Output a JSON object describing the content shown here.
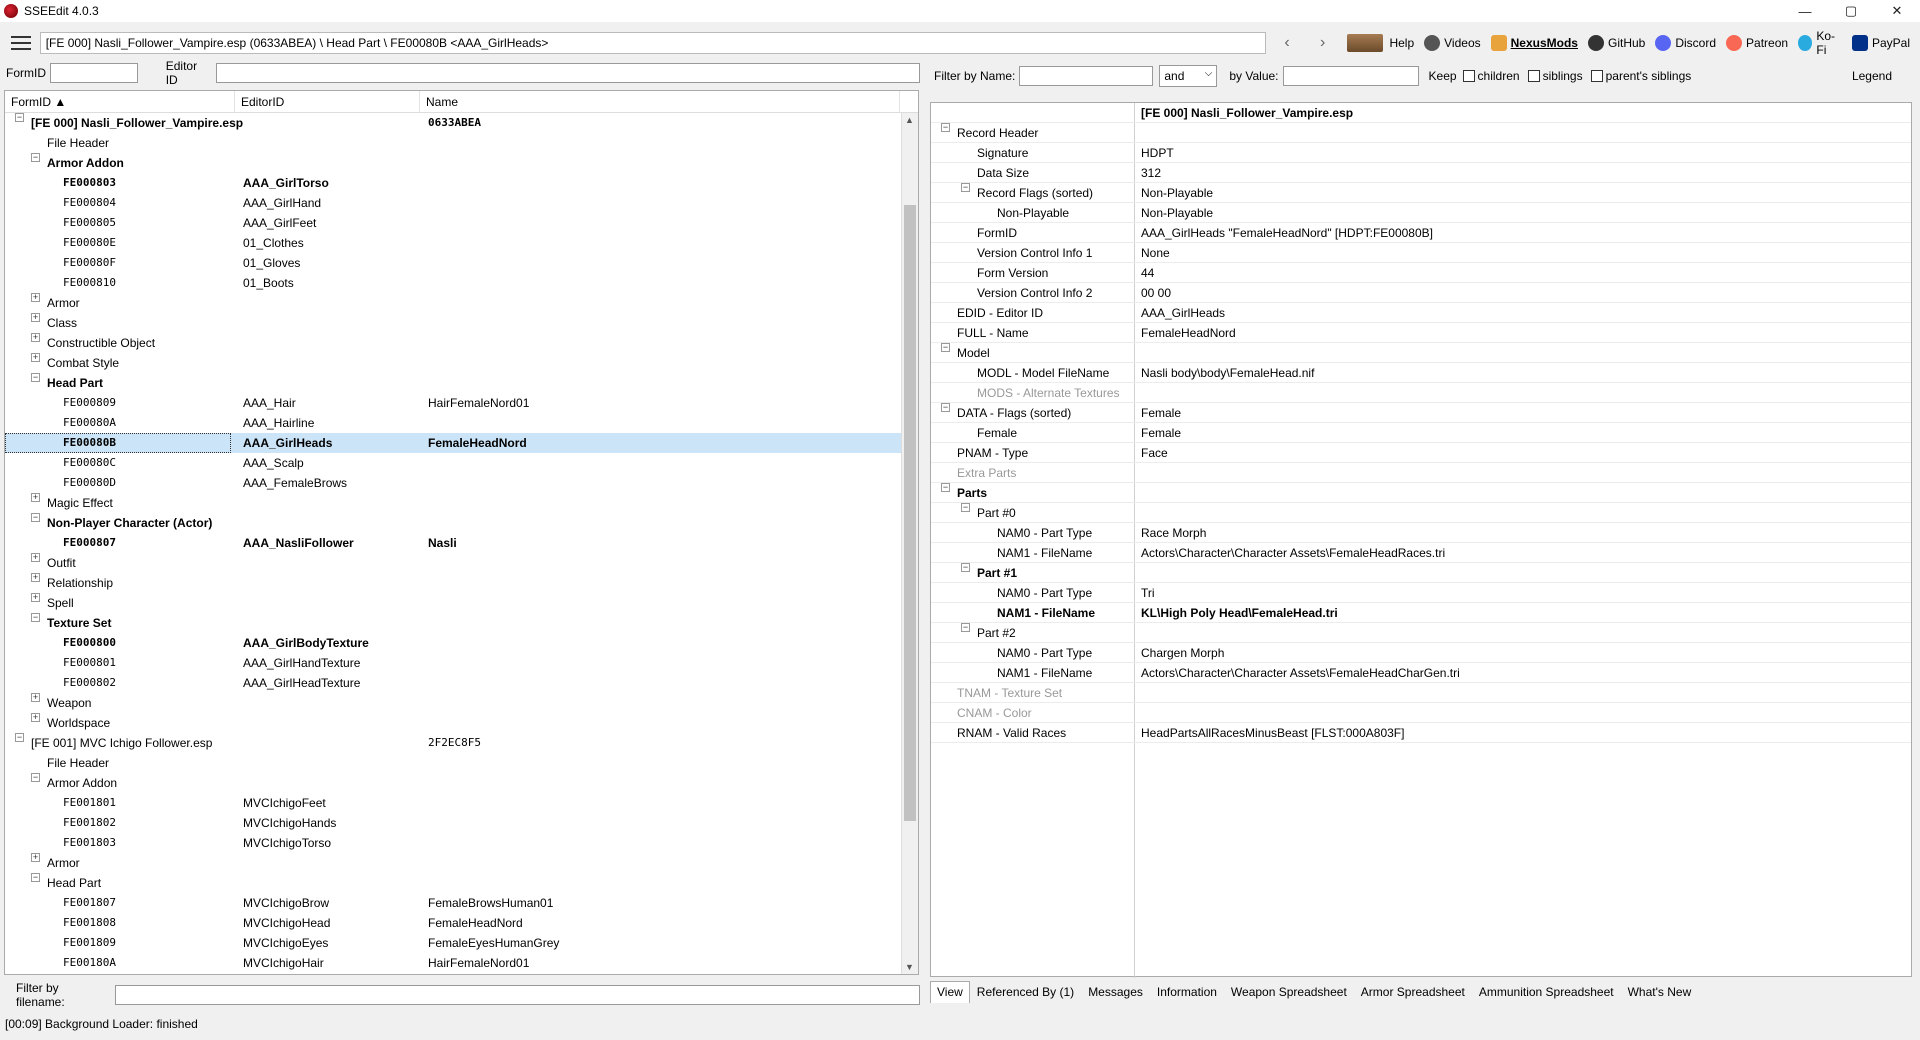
{
  "window": {
    "title": "SSEEdit 4.0.3",
    "min": "—",
    "max": "▢",
    "close": "✕"
  },
  "toolbar": {
    "path": "[FE 000] Nasli_Follower_Vampire.esp (0633ABEA) \\ Head Part \\ FE00080B <AAA_GirlHeads>",
    "back": "‹",
    "fwd": "›",
    "links": [
      "Help",
      "Videos",
      "NexusMods",
      "GitHub",
      "Discord",
      "Patreon",
      "Ko-Fi",
      "PayPal"
    ]
  },
  "leftfilter": {
    "formid_label": "FormID",
    "editorid_label": "Editor ID"
  },
  "lefttree": {
    "headers": [
      "FormID ▲",
      "EditorID",
      "Name"
    ],
    "rows": [
      {
        "d": 0,
        "e": "−",
        "id": "[FE 000] Nasli_Follower_Vampire.esp",
        "c3": "0633ABEA",
        "b": true
      },
      {
        "d": 1,
        "e": "",
        "id": "File Header"
      },
      {
        "d": 1,
        "e": "−",
        "id": "Armor Addon",
        "b": true
      },
      {
        "d": 2,
        "e": "",
        "id": "FE000803",
        "c2": "AAA_GirlTorso",
        "m": true,
        "b2": true
      },
      {
        "d": 2,
        "e": "",
        "id": "FE000804",
        "c2": "AAA_GirlHand",
        "m": true
      },
      {
        "d": 2,
        "e": "",
        "id": "FE000805",
        "c2": "AAA_GirlFeet",
        "m": true
      },
      {
        "d": 2,
        "e": "",
        "id": "FE00080E",
        "c2": "01_Clothes",
        "m": true
      },
      {
        "d": 2,
        "e": "",
        "id": "FE00080F",
        "c2": "01_Gloves",
        "m": true
      },
      {
        "d": 2,
        "e": "",
        "id": "FE000810",
        "c2": "01_Boots",
        "m": true
      },
      {
        "d": 1,
        "e": "+",
        "id": "Armor"
      },
      {
        "d": 1,
        "e": "+",
        "id": "Class"
      },
      {
        "d": 1,
        "e": "+",
        "id": "Constructible Object"
      },
      {
        "d": 1,
        "e": "+",
        "id": "Combat Style"
      },
      {
        "d": 1,
        "e": "−",
        "id": "Head Part",
        "b": true
      },
      {
        "d": 2,
        "e": "",
        "id": "FE000809",
        "c2": "AAA_Hair",
        "c3": "HairFemaleNord01",
        "m": true
      },
      {
        "d": 2,
        "e": "",
        "id": "FE00080A",
        "c2": "AAA_Hairline",
        "m": true
      },
      {
        "d": 2,
        "e": "",
        "id": "FE00080B",
        "c2": "AAA_GirlHeads",
        "c3": "FemaleHeadNord",
        "m": true,
        "b2": true,
        "sel": true
      },
      {
        "d": 2,
        "e": "",
        "id": "FE00080C",
        "c2": "AAA_Scalp",
        "m": true
      },
      {
        "d": 2,
        "e": "",
        "id": "FE00080D",
        "c2": "AAA_FemaleBrows",
        "m": true
      },
      {
        "d": 1,
        "e": "+",
        "id": "Magic Effect"
      },
      {
        "d": 1,
        "e": "−",
        "id": "Non-Player Character (Actor)",
        "b": true
      },
      {
        "d": 2,
        "e": "",
        "id": "FE000807",
        "c2": "AAA_NasliFollower",
        "c3": "Nasli",
        "m": true,
        "b2": true
      },
      {
        "d": 1,
        "e": "+",
        "id": "Outfit"
      },
      {
        "d": 1,
        "e": "+",
        "id": "Relationship"
      },
      {
        "d": 1,
        "e": "+",
        "id": "Spell"
      },
      {
        "d": 1,
        "e": "−",
        "id": "Texture Set",
        "b": true
      },
      {
        "d": 2,
        "e": "",
        "id": "FE000800",
        "c2": "AAA_GirlBodyTexture",
        "m": true,
        "b2": true
      },
      {
        "d": 2,
        "e": "",
        "id": "FE000801",
        "c2": "AAA_GirlHandTexture",
        "m": true
      },
      {
        "d": 2,
        "e": "",
        "id": "FE000802",
        "c2": "AAA_GirlHeadTexture",
        "m": true
      },
      {
        "d": 1,
        "e": "+",
        "id": "Weapon"
      },
      {
        "d": 1,
        "e": "+",
        "id": "Worldspace"
      },
      {
        "d": 0,
        "e": "−",
        "id": "[FE 001] MVC Ichigo Follower.esp",
        "c3": "2F2EC8F5"
      },
      {
        "d": 1,
        "e": "",
        "id": "File Header"
      },
      {
        "d": 1,
        "e": "−",
        "id": "Armor Addon"
      },
      {
        "d": 2,
        "e": "",
        "id": "FE001801",
        "c2": "MVCIchigoFeet",
        "m": true
      },
      {
        "d": 2,
        "e": "",
        "id": "FE001802",
        "c2": "MVCIchigoHands",
        "m": true
      },
      {
        "d": 2,
        "e": "",
        "id": "FE001803",
        "c2": "MVCIchigoTorso",
        "m": true
      },
      {
        "d": 1,
        "e": "+",
        "id": "Armor"
      },
      {
        "d": 1,
        "e": "−",
        "id": "Head Part"
      },
      {
        "d": 2,
        "e": "",
        "id": "FE001807",
        "c2": "MVCIchigoBrow",
        "c3": "FemaleBrowsHuman01",
        "m": true
      },
      {
        "d": 2,
        "e": "",
        "id": "FE001808",
        "c2": "MVCIchigoHead",
        "c3": "FemaleHeadNord",
        "m": true
      },
      {
        "d": 2,
        "e": "",
        "id": "FE001809",
        "c2": "MVCIchigoEyes",
        "c3": "FemaleEyesHumanGrey",
        "m": true
      },
      {
        "d": 2,
        "e": "",
        "id": "FE00180A",
        "c2": "MVCIchigoHair",
        "c3": "HairFemaleNord01",
        "m": true
      }
    ]
  },
  "filefilter": {
    "label": "Filter by filename:"
  },
  "rightfilter": {
    "byname": "Filter by Name:",
    "op": "and",
    "byvalue": "by Value:",
    "keep": "Keep",
    "children": "children",
    "siblings": "siblings",
    "parents": "parent's siblings",
    "legend": "Legend"
  },
  "righttree": {
    "header": "[FE 000] Nasli_Follower_Vampire.esp",
    "rows": [
      {
        "d": 0,
        "e": "−",
        "k": "Record Header",
        "v": ""
      },
      {
        "d": 1,
        "e": "",
        "k": "Signature",
        "v": "HDPT"
      },
      {
        "d": 1,
        "e": "",
        "k": "Data Size",
        "v": "312"
      },
      {
        "d": 1,
        "e": "−",
        "k": "Record Flags (sorted)",
        "v": "Non-Playable"
      },
      {
        "d": 2,
        "e": "",
        "k": "Non-Playable",
        "v": "Non-Playable"
      },
      {
        "d": 1,
        "e": "",
        "k": "FormID",
        "v": "AAA_GirlHeads \"FemaleHeadNord\" [HDPT:FE00080B]"
      },
      {
        "d": 1,
        "e": "",
        "k": "Version Control Info 1",
        "v": "None"
      },
      {
        "d": 1,
        "e": "",
        "k": "Form Version",
        "v": "44"
      },
      {
        "d": 1,
        "e": "",
        "k": "Version Control Info 2",
        "v": "00 00"
      },
      {
        "d": 0,
        "e": "",
        "k": "EDID - Editor ID",
        "v": "AAA_GirlHeads"
      },
      {
        "d": 0,
        "e": "",
        "k": "FULL - Name",
        "v": "FemaleHeadNord"
      },
      {
        "d": 0,
        "e": "−",
        "k": "Model",
        "v": ""
      },
      {
        "d": 1,
        "e": "",
        "k": "MODL - Model FileName",
        "v": "Nasli body\\body\\FemaleHead.nif"
      },
      {
        "d": 1,
        "e": "",
        "k": "MODS - Alternate Textures",
        "v": "",
        "g": true
      },
      {
        "d": 0,
        "e": "−",
        "k": "DATA - Flags (sorted)",
        "v": "Female"
      },
      {
        "d": 1,
        "e": "",
        "k": "Female",
        "v": "Female"
      },
      {
        "d": 0,
        "e": "",
        "k": "PNAM - Type",
        "v": "Face"
      },
      {
        "d": 0,
        "e": "",
        "k": "Extra Parts",
        "v": "",
        "g": true
      },
      {
        "d": 0,
        "e": "−",
        "k": "Parts",
        "v": "",
        "b": true
      },
      {
        "d": 1,
        "e": "−",
        "k": "Part #0",
        "v": ""
      },
      {
        "d": 2,
        "e": "",
        "k": "NAM0 - Part Type",
        "v": "Race Morph"
      },
      {
        "d": 2,
        "e": "",
        "k": "NAM1 - FileName",
        "v": "Actors\\Character\\Character Assets\\FemaleHeadRaces.tri"
      },
      {
        "d": 1,
        "e": "−",
        "k": "Part #1",
        "v": "",
        "b": true
      },
      {
        "d": 2,
        "e": "",
        "k": "NAM0 - Part Type",
        "v": "Tri"
      },
      {
        "d": 2,
        "e": "",
        "k": "NAM1 - FileName",
        "v": "KL\\High Poly Head\\FemaleHead.tri",
        "b": true
      },
      {
        "d": 1,
        "e": "−",
        "k": "Part #2",
        "v": ""
      },
      {
        "d": 2,
        "e": "",
        "k": "NAM0 - Part Type",
        "v": "Chargen Morph"
      },
      {
        "d": 2,
        "e": "",
        "k": "NAM1 - FileName",
        "v": "Actors\\Character\\Character Assets\\FemaleHeadCharGen.tri"
      },
      {
        "d": 0,
        "e": "",
        "k": "TNAM - Texture Set",
        "v": "",
        "g": true
      },
      {
        "d": 0,
        "e": "",
        "k": "CNAM - Color",
        "v": "",
        "g": true
      },
      {
        "d": 0,
        "e": "",
        "k": "RNAM - Valid Races",
        "v": "HeadPartsAllRacesMinusBeast [FLST:000A803F]"
      }
    ]
  },
  "tabs": [
    "View",
    "Referenced By (1)",
    "Messages",
    "Information",
    "Weapon Spreadsheet",
    "Armor Spreadsheet",
    "Ammunition Spreadsheet",
    "What's New"
  ],
  "status": "[00:09] Background Loader: finished",
  "colors": {
    "selection": "#cce4f7",
    "accent": "#d23"
  }
}
